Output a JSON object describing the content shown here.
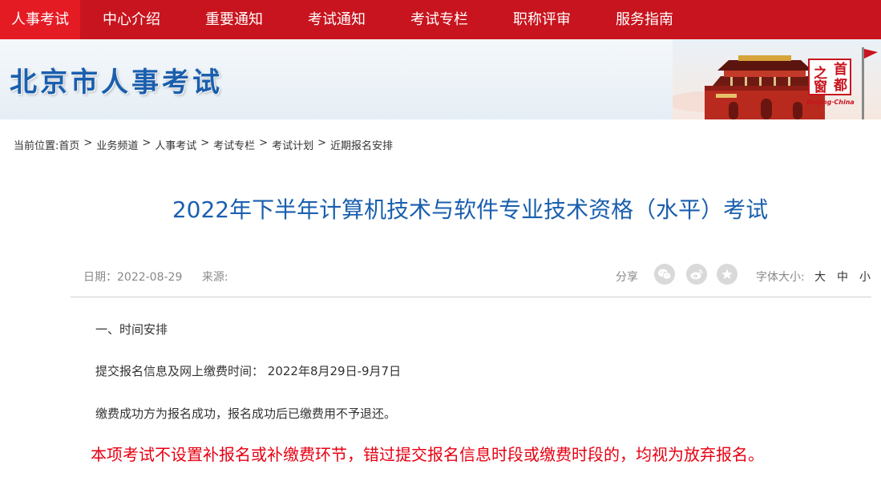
{
  "nav": {
    "items": [
      {
        "label": "人事考试"
      },
      {
        "label": "中心介绍"
      },
      {
        "label": "重要通知"
      },
      {
        "label": "考试通知"
      },
      {
        "label": "考试专栏"
      },
      {
        "label": "职称评审"
      },
      {
        "label": "服务指南"
      }
    ]
  },
  "banner": {
    "site_title": "北京市人事考试",
    "seal_chars": [
      "首",
      "之",
      "都",
      "窗"
    ],
    "seal_caption": "Beijing·China"
  },
  "breadcrumb": {
    "prefix": "当前位置:",
    "items": [
      "首页",
      "业务频道",
      "人事考试",
      "考试专栏",
      "考试计划",
      "近期报名安排"
    ],
    "separator": ">"
  },
  "article": {
    "title": "2022年下半年计算机技术与软件专业技术资格（水平）考试",
    "date": "日期：2022-08-29",
    "source": "来源:",
    "share_label": "分享",
    "share_icons": [
      "wechat-icon",
      "weibo-icon",
      "favorite-icon"
    ],
    "font_size_label": "字体大小:",
    "font_sizes": [
      "大",
      "中",
      "小"
    ],
    "paragraphs": [
      "一、时间安排",
      "提交报名信息及网上缴费时间：  2022年8月29日-9月7日",
      "缴费成功方为报名成功，报名成功后已缴费用不予退还。"
    ],
    "warning": "本项考试不设置补报名或补缴费环节，错过提交报名信息时段或缴费时段的，均视为放弃报名。"
  },
  "colors": {
    "nav_bg": "#c8141e",
    "nav_active": "#e51b24",
    "title_blue": "#1a5fae",
    "warning_red": "#e60012"
  }
}
